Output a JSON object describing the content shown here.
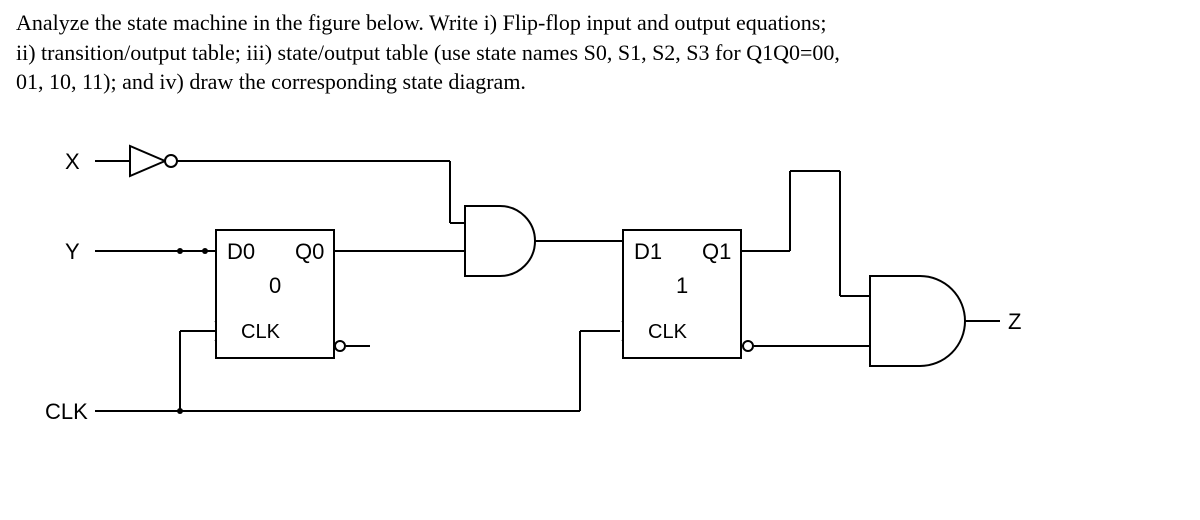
{
  "question": {
    "line1": "Analyze the state machine in the figure below. Write i) Flip-flop input and output equations;",
    "line2": "ii) transition/output table; iii) state/output table (use state names S0, S1, S2, S3 for Q1Q0=00,",
    "line3": "01, 10, 11); and iv) draw the corresponding state diagram."
  },
  "inputs": {
    "x": "X",
    "y": "Y",
    "clk": "CLK"
  },
  "flipflops": {
    "ff0": {
      "d": "D0",
      "q": "Q0",
      "index": "0",
      "clk": "CLK"
    },
    "ff1": {
      "d": "D1",
      "q": "Q1",
      "index": "1",
      "clk": "CLK"
    }
  },
  "output": {
    "z": "Z"
  },
  "chart_data": {
    "type": "diagram",
    "kind": "sequential-circuit",
    "inputs": [
      "X",
      "Y",
      "CLK"
    ],
    "outputs": [
      "Z"
    ],
    "state_bits": [
      "Q1",
      "Q0"
    ],
    "flipflops": [
      {
        "name": "FF0",
        "type": "D",
        "d": "D0",
        "q": "Q0",
        "clk": "CLK"
      },
      {
        "name": "FF1",
        "type": "D",
        "d": "D1",
        "q": "Q1",
        "clk": "CLK"
      }
    ],
    "gates": [
      {
        "name": "NOT1",
        "type": "NOT",
        "inputs": [
          "X"
        ],
        "output": "Xn"
      },
      {
        "name": "AND1",
        "type": "AND",
        "inputs": [
          "Xn",
          "Q0"
        ],
        "output": "D1"
      },
      {
        "name": "AND2",
        "type": "AND",
        "inputs": [
          "Q1",
          "Q0n"
        ],
        "output": "Z"
      }
    ],
    "equations": {
      "D0": "Y",
      "D1": "X' · Q0",
      "Z": "Q1 · Q0'"
    },
    "state_encoding": {
      "S0": "00",
      "S1": "01",
      "S2": "10",
      "S3": "11"
    }
  }
}
